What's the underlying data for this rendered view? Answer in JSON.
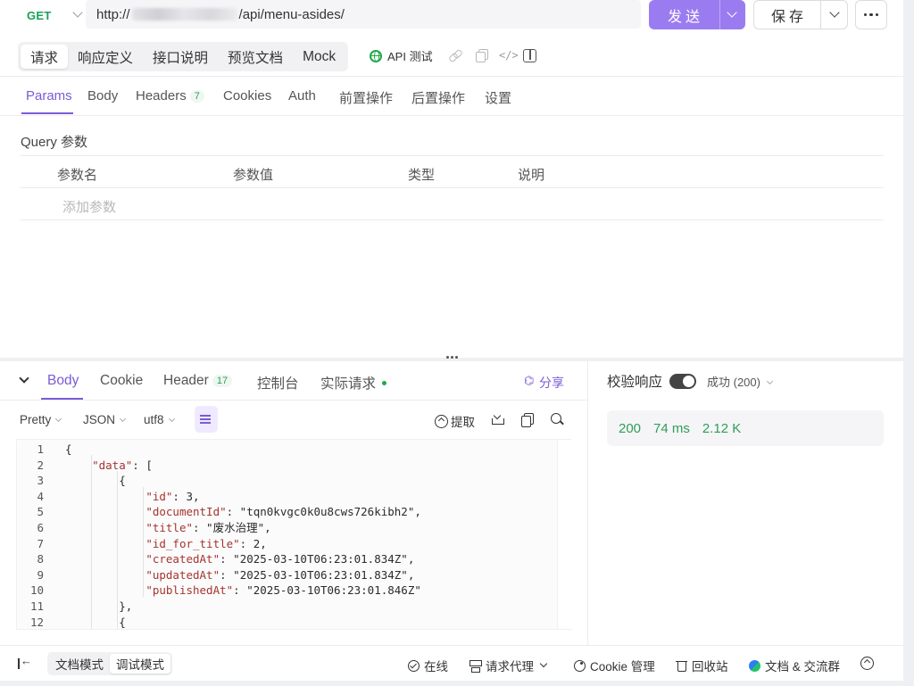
{
  "urlbar": {
    "method": "GET",
    "url_prefix": "http://",
    "url_suffix": "/api/menu-asides/",
    "send_label": "发送",
    "save_label": "保存"
  },
  "request_tabs": [
    "请求",
    "响应定义",
    "接口说明",
    "预览文档",
    "Mock"
  ],
  "api_test_label": "API 测试",
  "param_tabs": {
    "params": "Params",
    "body": "Body",
    "headers": "Headers",
    "headers_count": "7",
    "cookies": "Cookies",
    "auth": "Auth",
    "pre": "前置操作",
    "post": "后置操作",
    "settings": "设置"
  },
  "query": {
    "title": "Query 参数",
    "columns": [
      "参数名",
      "参数值",
      "类型",
      "说明"
    ],
    "add_placeholder": "添加参数"
  },
  "response_tabs": {
    "body": "Body",
    "cookie": "Cookie",
    "header": "Header",
    "header_count": "17",
    "console": "控制台",
    "actual": "实际请求",
    "share": "分享"
  },
  "format_bar": {
    "pretty": "Pretty",
    "json": "JSON",
    "encoding": "utf8",
    "extract": "提取"
  },
  "code_lines": [
    {
      "n": "1",
      "text": "{"
    },
    {
      "n": "2",
      "text": "\"data\": ["
    },
    {
      "n": "3",
      "text": "{"
    },
    {
      "n": "4",
      "text": "\"id\": 3,"
    },
    {
      "n": "5",
      "text": "\"documentId\": \"tqn0kvgc0k0u8cws726kibh2\","
    },
    {
      "n": "6",
      "text": "\"title\": \"废水治理\","
    },
    {
      "n": "7",
      "text": "\"id_for_title\": 2,"
    },
    {
      "n": "8",
      "text": "\"createdAt\": \"2025-03-10T06:23:01.834Z\","
    },
    {
      "n": "9",
      "text": "\"updatedAt\": \"2025-03-10T06:23:01.834Z\","
    },
    {
      "n": "10",
      "text": "\"publishedAt\": \"2025-03-10T06:23:01.846Z\""
    },
    {
      "n": "11",
      "text": "},"
    },
    {
      "n": "12",
      "text": "{"
    }
  ],
  "verify": {
    "label": "校验响应",
    "result": "成功 (200)"
  },
  "stats": {
    "status": "200",
    "time": "74 ms",
    "size": "2.12 K"
  },
  "footer": {
    "doc_mode": "文档模式",
    "debug_mode": "调试模式",
    "online": "在线",
    "proxy": "请求代理",
    "cookie_mgr": "Cookie 管理",
    "trash": "回收站",
    "community": "文档 & 交流群"
  },
  "colors": {
    "accent": "#7b5bd6",
    "send_button": "#9b7cf0",
    "method_get": "#18a058",
    "status_green": "#2f9e5a"
  }
}
